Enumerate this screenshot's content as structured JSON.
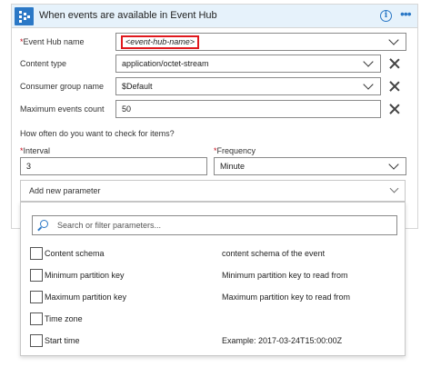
{
  "header": {
    "title": "When events are available in Event Hub",
    "info_glyph": "i",
    "more_glyph": "•••",
    "accent_color": "#2b78c6"
  },
  "fields": {
    "event_hub_name": {
      "label": "Event Hub name",
      "required": "*",
      "value": "<event-hub-name>"
    },
    "content_type": {
      "label": "Content type",
      "value": "application/octet-stream"
    },
    "consumer_group": {
      "label": "Consumer group name",
      "value": "$Default"
    },
    "max_events": {
      "label": "Maximum events count",
      "value": "50"
    }
  },
  "recurrence": {
    "question": "How often do you want to check for items?",
    "interval_label": "Interval",
    "interval_required": "*",
    "interval_value": "3",
    "frequency_label": "Frequency",
    "frequency_required": "*",
    "frequency_value": "Minute"
  },
  "add_parameter": {
    "label": "Add new parameter"
  },
  "parameter_panel": {
    "search_placeholder": "Search or filter parameters...",
    "items": [
      {
        "name": "Content schema",
        "description": "content schema of the event"
      },
      {
        "name": "Minimum partition key",
        "description": "Minimum partition key to read from"
      },
      {
        "name": "Maximum partition key",
        "description": "Maximum partition key to read from"
      },
      {
        "name": "Time zone",
        "description": ""
      },
      {
        "name": "Start time",
        "description": "Example: 2017-03-24T15:00:00Z"
      }
    ]
  },
  "colors": {
    "header_bg": "#e6f2fb",
    "highlight_border": "#e0191e",
    "required_marker": "#c50f1f"
  }
}
